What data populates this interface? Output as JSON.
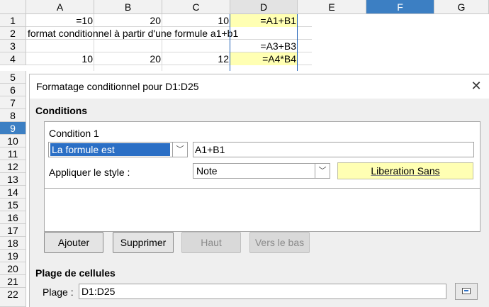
{
  "spreadsheet": {
    "columns": [
      "A",
      "B",
      "C",
      "D",
      "E",
      "F",
      "G"
    ],
    "rows": [
      "1",
      "2",
      "3",
      "4",
      "5",
      "6",
      "7",
      "8",
      "9",
      "10",
      "11",
      "12",
      "13",
      "14",
      "15",
      "16",
      "17",
      "18",
      "19",
      "20",
      "21",
      "22"
    ],
    "selected_column": "F",
    "selected_row": "9",
    "cells": {
      "A1": "=10",
      "B1": "20",
      "C1": "10",
      "D1": "=A1+B1",
      "A2": "format conditionnel à partir d'une formule a1+b1",
      "D3": "=A3+B3",
      "A4": "10",
      "B4": "20",
      "C4": "12",
      "D4": "=A4*B4"
    },
    "highlight_color": "#ffffb3"
  },
  "dialog": {
    "title": "Formatage conditionnel pour D1:D25",
    "conditions_heading": "Conditions",
    "condition_label": "Condition 1",
    "condition_type": "La formule est",
    "formula_value": "A1+B1",
    "apply_style_label": "Appliquer le style :",
    "style_value": "Note",
    "preview_text": "Liberation Sans",
    "buttons": {
      "add": "Ajouter",
      "delete": "Supprimer",
      "up": "Haut",
      "down": "Vers le bas"
    },
    "range_heading": "Plage de cellules",
    "range_label": "Plage :",
    "range_value": "D1:D25",
    "icons": {
      "close": "close-icon",
      "shrink": "shrink-dialog-icon",
      "dropdown": "chevron-down-icon"
    }
  }
}
